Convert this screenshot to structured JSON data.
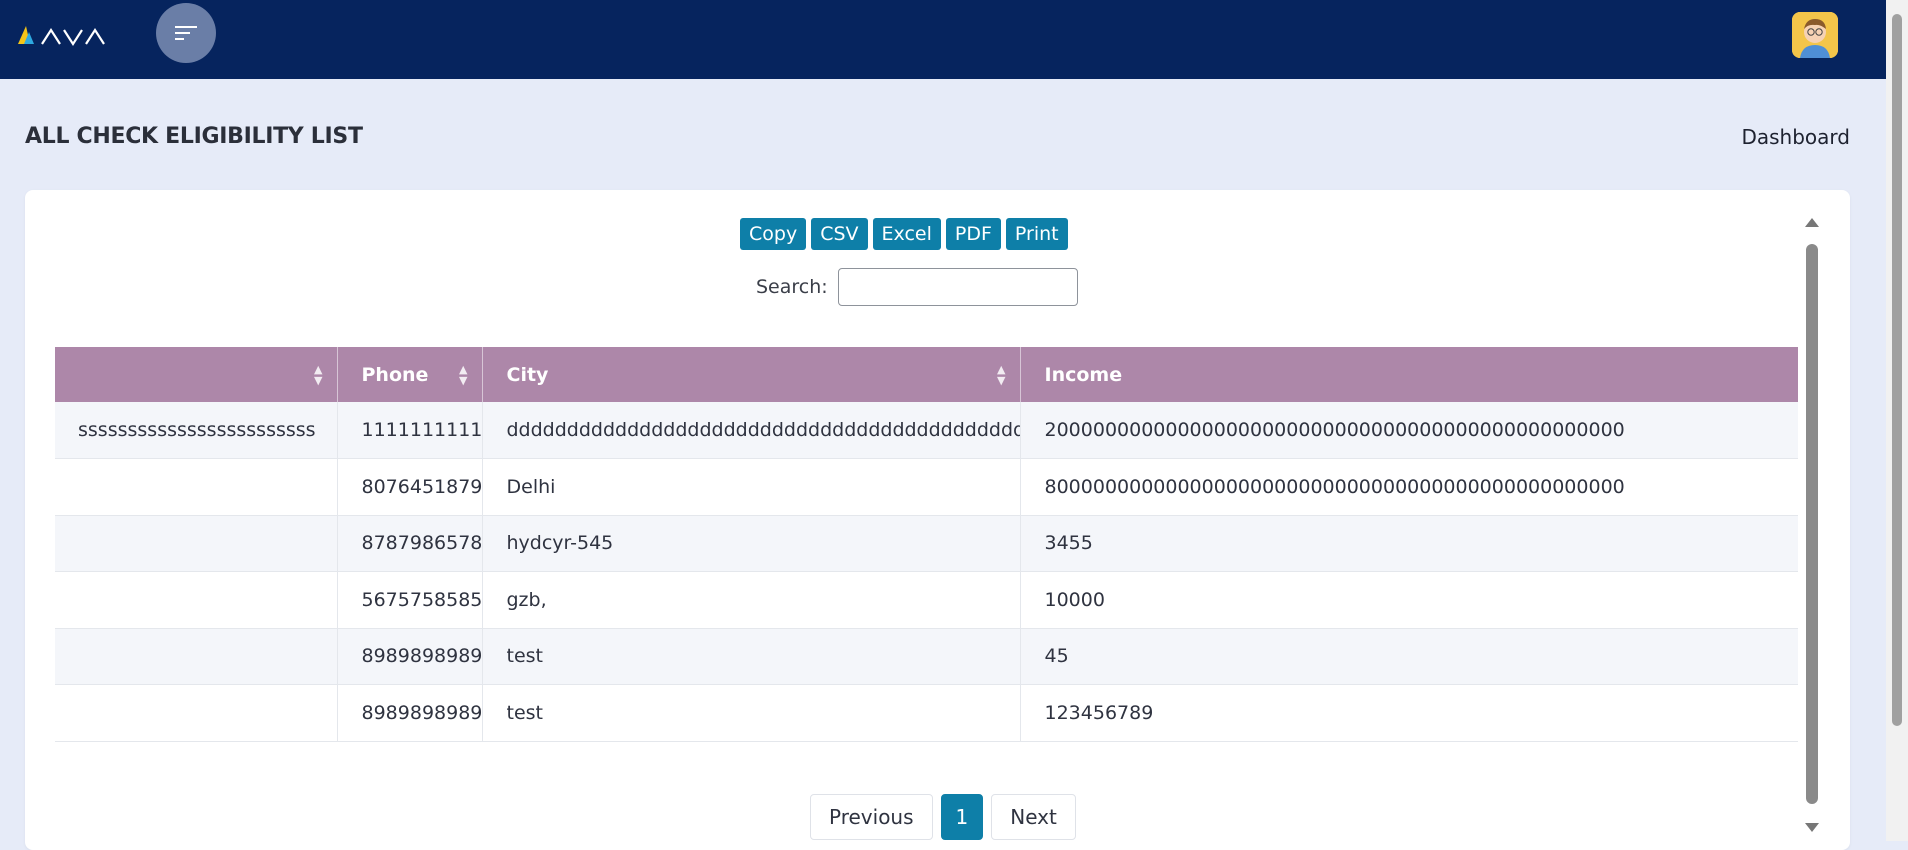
{
  "header": {
    "logo_text": "AVA",
    "menu_icon": "menu-lines-icon",
    "avatar_icon": "user-avatar-icon"
  },
  "page": {
    "title": "ALL CHECK ELIGIBILITY LIST",
    "breadcrumb": "Dashboard"
  },
  "toolbar": {
    "buttons": [
      "Copy",
      "CSV",
      "Excel",
      "PDF",
      "Print"
    ],
    "search_label": "Search:",
    "search_value": ""
  },
  "table": {
    "columns": [
      "",
      "Phone",
      "City",
      "Income"
    ],
    "rows": [
      {
        "name": "ssssssssssssssssssssssss",
        "phone": "1111111111",
        "city": "dddddddddddddddddddddddddddddddddddddddddddddddd",
        "income": "200000000000000000000000000000000000000000000000"
      },
      {
        "name": "",
        "phone": "8076451879",
        "city": "Delhi",
        "income": "800000000000000000000000000000000000000000000000"
      },
      {
        "name": "",
        "phone": "8787986578",
        "city": "hydcyr-545",
        "income": "3455"
      },
      {
        "name": "",
        "phone": "5675758585",
        "city": "gzb,",
        "income": "10000"
      },
      {
        "name": "",
        "phone": "8989898989",
        "city": "test",
        "income": "45"
      },
      {
        "name": "",
        "phone": "8989898989",
        "city": "test",
        "income": "123456789"
      }
    ]
  },
  "pagination": {
    "previous": "Previous",
    "current": "1",
    "next": "Next"
  },
  "colors": {
    "topbar": "#06245e",
    "accent": "#0e7fa8",
    "table_header": "#ad87a9",
    "background": "#e6ebf8"
  }
}
